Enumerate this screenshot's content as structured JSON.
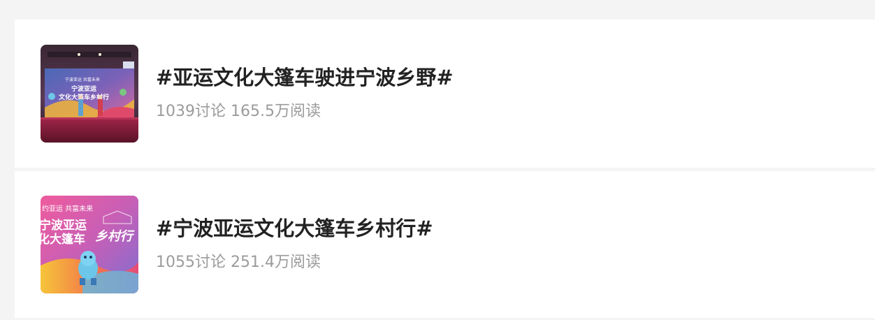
{
  "topics": [
    {
      "title": "#亚运文化大篷车驶进宁波乡野#",
      "discussions": "1039讨论",
      "reads": "165.5万阅读",
      "thumbnail": {
        "label_top": "宁波亚运 共富未来",
        "label_main_1": "宁波亚运",
        "label_main_2": "文化大篷车乡村行"
      }
    },
    {
      "title": "#宁波亚运文化大篷车乡村行#",
      "discussions": "1055讨论",
      "reads": "251.4万阅读",
      "thumbnail": {
        "label_top": "约亚运 共富未来",
        "label_main_1": "宁波亚运",
        "label_main_2": "化大篷车",
        "label_main_3": "乡村行"
      }
    }
  ]
}
